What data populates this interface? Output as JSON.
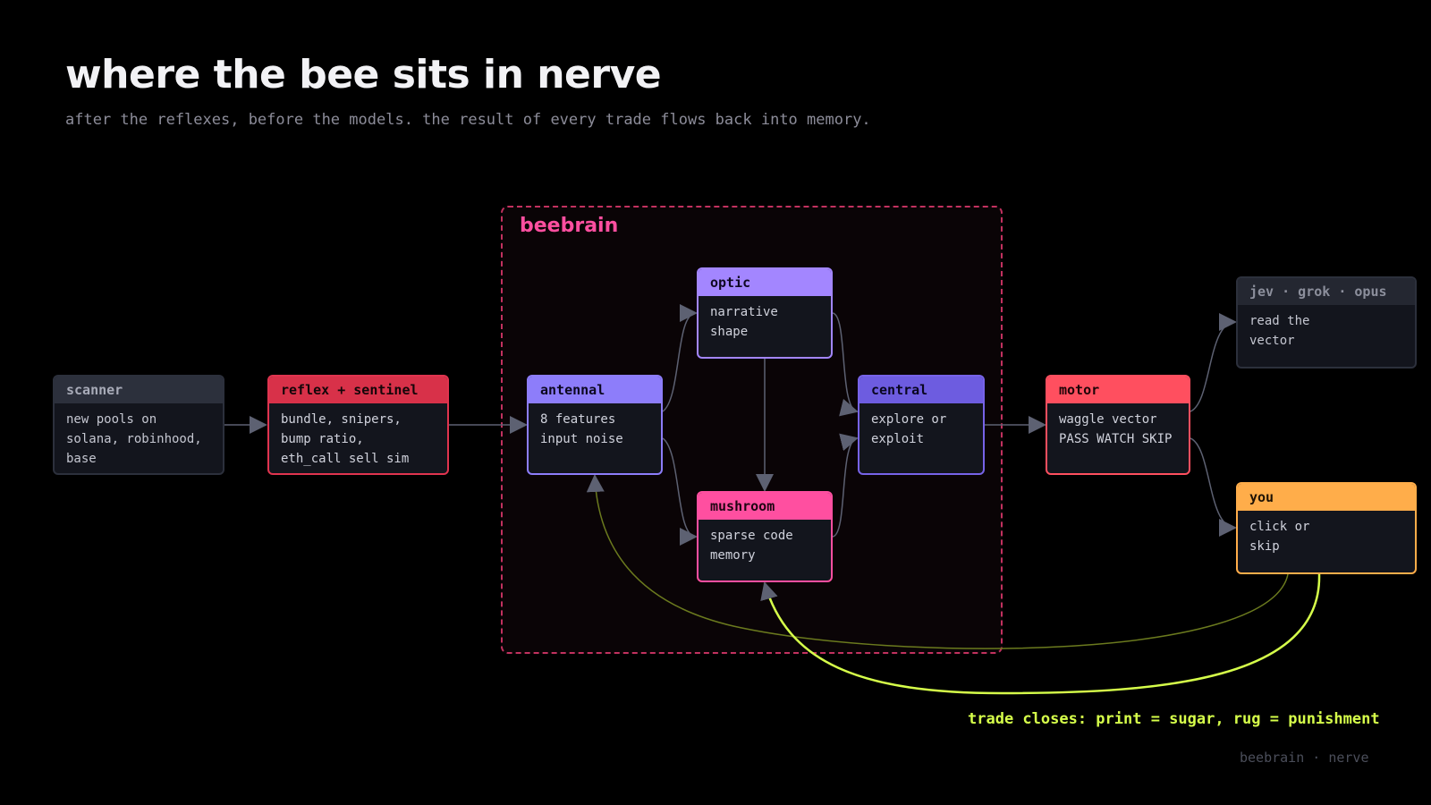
{
  "header": {
    "title": "where the bee sits in nerve",
    "subtitle": "after the reflexes, before the models. the result of every trade flows back into memory."
  },
  "group": {
    "label": "beebrain",
    "color": "#ff4fa0"
  },
  "nodes": {
    "scanner": {
      "title": "scanner",
      "body": "new pools on\nsolana, robinhood,\nbase",
      "color": "#2c303c"
    },
    "reflex": {
      "title": "reflex + sentinel",
      "body": "bundle, snipers,\nbump ratio,\neth_call sell sim",
      "color": "#d83149"
    },
    "antennal": {
      "title": "antennal",
      "body": "8 features\ninput noise",
      "color": "#8d7dfa"
    },
    "optic": {
      "title": "optic",
      "body": "narrative\nshape",
      "color": "#a386ff"
    },
    "mushroom": {
      "title": "mushroom",
      "body": "sparse code\nmemory",
      "color": "#ff4fa0"
    },
    "central": {
      "title": "central",
      "body": "explore or\nexploit",
      "color": "#6d5ce0"
    },
    "motor": {
      "title": "motor",
      "body": "waggle vector\nPASS WATCH SKIP",
      "color": "#ff4f5f"
    },
    "models": {
      "title": "jev · grok · opus",
      "body": "read the\nvector",
      "color": "#242731"
    },
    "you": {
      "title": "you",
      "body": "click or\nskip",
      "color": "#ffad4a"
    }
  },
  "feedback": {
    "caption": "trade closes: print = sugar, rug = punishment",
    "color": "#d6ff4a"
  },
  "footer": {
    "text": "beebrain · nerve"
  }
}
